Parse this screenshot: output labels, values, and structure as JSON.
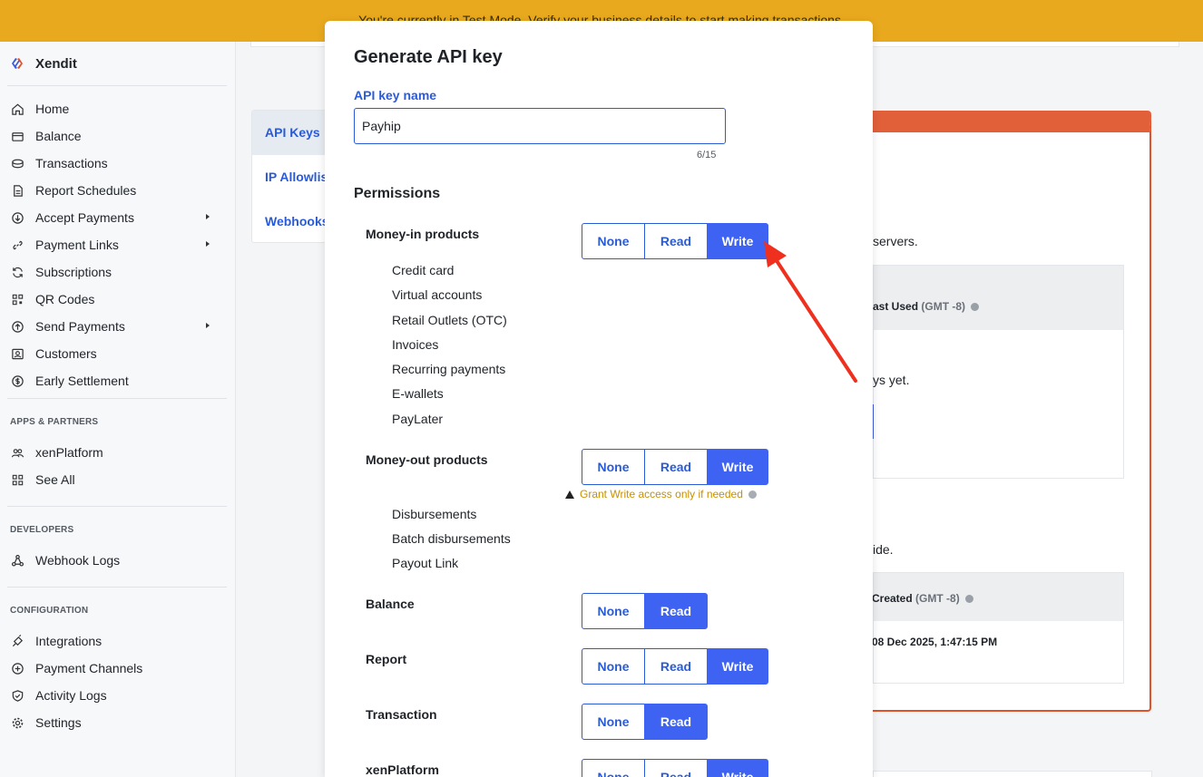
{
  "banner": {
    "text": "You're currently in Test Mode. Verify your business details to start making transactions."
  },
  "brand": {
    "name": "Xendit"
  },
  "sidebar": {
    "main": [
      {
        "label": "Home",
        "icon": "home-icon"
      },
      {
        "label": "Balance",
        "icon": "wallet-icon"
      },
      {
        "label": "Transactions",
        "icon": "coins-icon"
      },
      {
        "label": "Report Schedules",
        "icon": "document-icon"
      },
      {
        "label": "Accept Payments",
        "icon": "download-circle-icon",
        "expandable": true
      },
      {
        "label": "Payment Links",
        "icon": "link-icon",
        "expandable": true
      },
      {
        "label": "Subscriptions",
        "icon": "refresh-icon"
      },
      {
        "label": "QR Codes",
        "icon": "qr-icon"
      },
      {
        "label": "Send Payments",
        "icon": "upload-circle-icon",
        "expandable": true
      },
      {
        "label": "Customers",
        "icon": "contact-icon"
      },
      {
        "label": "Early Settlement",
        "icon": "dollar-circle-icon"
      }
    ],
    "apps_title": "APPS & PARTNERS",
    "apps": [
      {
        "label": "xenPlatform",
        "icon": "users-icon"
      },
      {
        "label": "See All",
        "icon": "grid-icon"
      }
    ],
    "dev_title": "DEVELOPERS",
    "dev": [
      {
        "label": "Webhook Logs",
        "icon": "webhook-icon"
      }
    ],
    "config_title": "CONFIGURATION",
    "config": [
      {
        "label": "Integrations",
        "icon": "plug-icon"
      },
      {
        "label": "Payment Channels",
        "icon": "plus-circle-icon"
      },
      {
        "label": "Activity Logs",
        "icon": "shield-icon"
      },
      {
        "label": "Settings",
        "icon": "gear-icon"
      }
    ]
  },
  "tabs": [
    {
      "label": "API Keys",
      "active": true
    },
    {
      "label": "IP Allowlis"
    },
    {
      "label": "Webhooks"
    }
  ],
  "background": {
    "servers_text": "servers.",
    "last_used_label": "ast Used",
    "last_used_tz": "(GMT -8)",
    "no_keys_text": "ys yet.",
    "guide_text": "ide.",
    "created_label": "Created",
    "created_tz": "(GMT -8)",
    "created_value": "08 Dec 2025, 1:47:15 PM"
  },
  "modal": {
    "title": "Generate API key",
    "name_label": "API key name",
    "name_value": "Payhip",
    "counter": "6/15",
    "permissions_title": "Permissions",
    "options": {
      "none": "None",
      "read": "Read",
      "write": "Write"
    },
    "warning": "Grant Write access only if needed",
    "groups": [
      {
        "label": "Money-in products",
        "selected": "write",
        "has_write": true,
        "items": [
          "Credit card",
          "Virtual accounts",
          "Retail Outlets (OTC)",
          "Invoices",
          "Recurring payments",
          "E-wallets",
          "PayLater"
        ]
      },
      {
        "label": "Money-out products",
        "selected": "write",
        "has_write": true,
        "items": [
          "Disbursements",
          "Batch disbursements",
          "Payout Link"
        ]
      },
      {
        "label": "Balance",
        "selected": "read",
        "has_write": false,
        "items": []
      },
      {
        "label": "Report",
        "selected": "write",
        "has_write": true,
        "items": []
      },
      {
        "label": "Transaction",
        "selected": "read",
        "has_write": false,
        "items": []
      },
      {
        "label": "xenPlatform",
        "selected": "write",
        "has_write": true,
        "items": []
      }
    ]
  },
  "colors": {
    "accent": "#3e63f2",
    "banner": "#e8a91e",
    "annotation_arrow": "#f0301e",
    "warning": "#c89000"
  }
}
